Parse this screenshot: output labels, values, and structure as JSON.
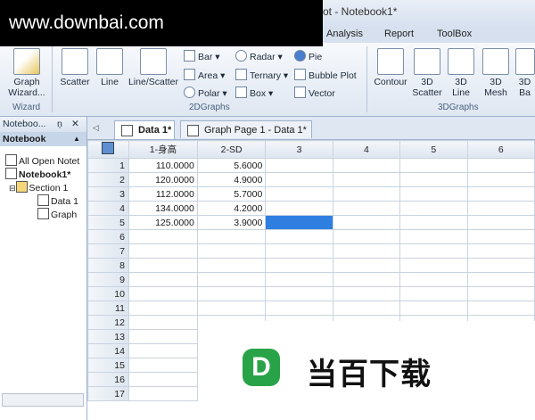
{
  "watermark": "www.downbai.com",
  "title": "ot - Notebook1*",
  "menu": [
    "Analysis",
    "Report",
    "ToolBox"
  ],
  "ribbon": {
    "wizard_group_label": "Wizard",
    "graph_wizard": "Graph\nWizard...",
    "scatter": "Scatter",
    "line": "Line",
    "line_scatter": "Line/Scatter",
    "bar": "Bar",
    "area": "Area",
    "polar": "Polar",
    "radar": "Radar",
    "ternary": "Ternary",
    "box": "Box",
    "pie": "Pie",
    "bubble": "Bubble Plot",
    "vector": "Vector",
    "group2d": "2DGraphs",
    "contour": "Contour",
    "scatter3d": "3D\nScatter",
    "line3d": "3D\nLine",
    "mesh3d": "3D\nMesh",
    "bar3d": "3D\nBa",
    "group3d": "3DGraphs"
  },
  "left": {
    "header": "Noteboo...",
    "pin": "ņ",
    "close": "✕",
    "sub": "Notebook",
    "tree": [
      "All Open Notet",
      "Notebook1*",
      "Section 1",
      "Data 1",
      "Graph"
    ]
  },
  "tabs": [
    "Data 1*",
    "Graph Page 1 - Data 1*"
  ],
  "grid": {
    "columns": [
      "1-身高",
      "2-SD",
      "3",
      "4",
      "5",
      "6"
    ],
    "rows": [
      [
        "1",
        "110.0000",
        "5.6000"
      ],
      [
        "2",
        "120.0000",
        "4.9000"
      ],
      [
        "3",
        "112.0000",
        "5.7000"
      ],
      [
        "4",
        "134.0000",
        "4.2000"
      ],
      [
        "5",
        "125.0000",
        "3.9000"
      ],
      [
        "6",
        "",
        ""
      ],
      [
        "7",
        "",
        ""
      ],
      [
        "8",
        "",
        ""
      ],
      [
        "9",
        "",
        ""
      ],
      [
        "10",
        "",
        ""
      ],
      [
        "11",
        "",
        ""
      ],
      [
        "12",
        "",
        ""
      ],
      [
        "13",
        "",
        ""
      ],
      [
        "14",
        "",
        ""
      ],
      [
        "15",
        "",
        ""
      ],
      [
        "16",
        "",
        ""
      ],
      [
        "17",
        "",
        ""
      ]
    ]
  },
  "logo": {
    "letter": "D",
    "text": "当百下载"
  }
}
